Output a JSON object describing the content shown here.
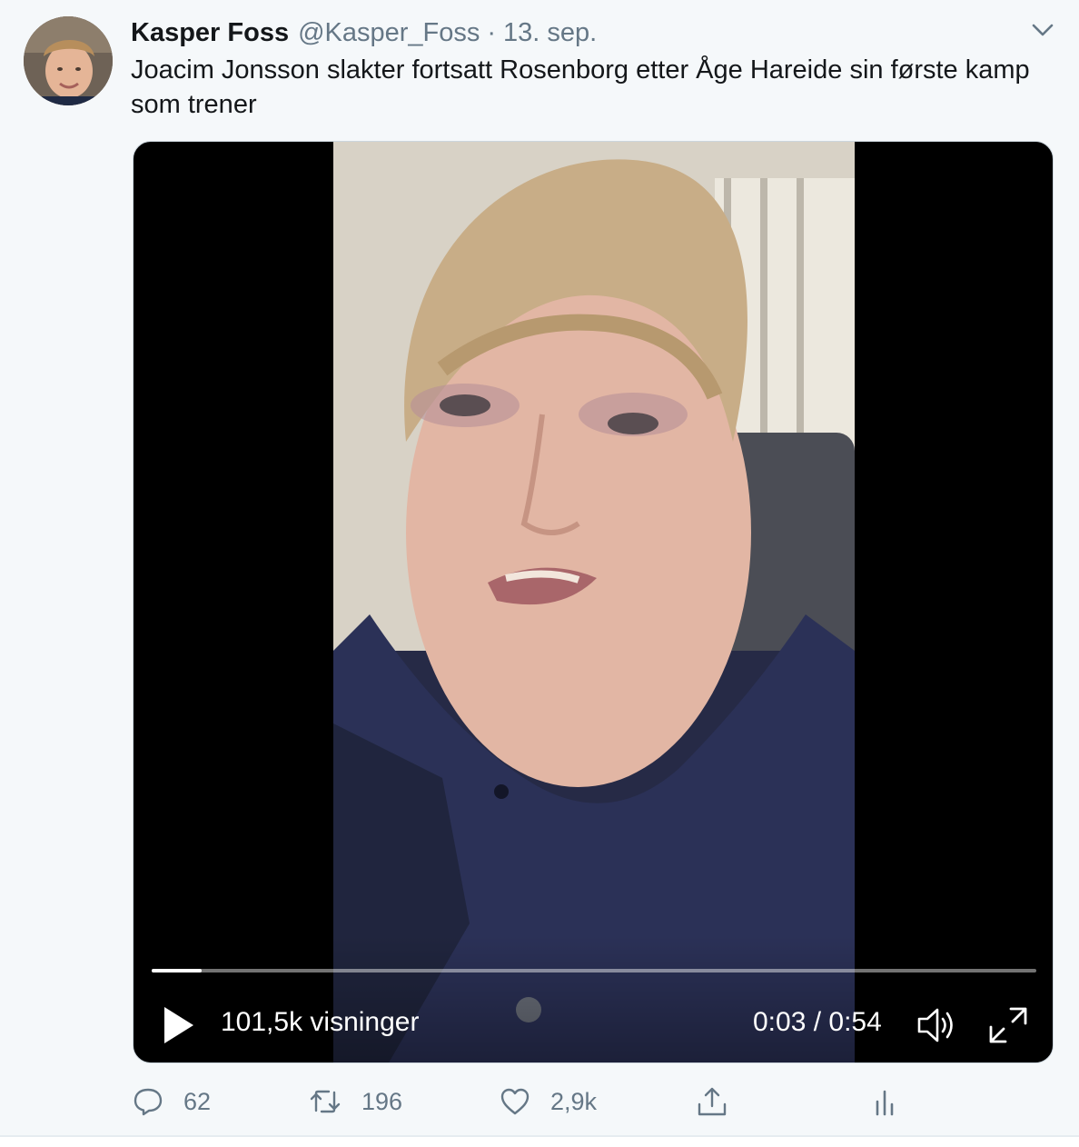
{
  "tweet": {
    "author_name": "Kasper Foss",
    "handle": "@Kasper_Foss",
    "separator": "·",
    "date": "13. sep.",
    "text": "Joacim Jonsson slakter fortsatt Rosenborg etter Åge Hareide sin første kamp som trener"
  },
  "video": {
    "views": "101,5k visninger",
    "time": "0:03 / 0:54",
    "progress": 0.056
  },
  "actions": {
    "replies": "62",
    "retweets": "196",
    "likes": "2,9k"
  },
  "icons": {
    "caret": "chevron-down-icon",
    "play": "play-icon",
    "volume": "volume-icon",
    "fullscreen": "fullscreen-icon",
    "reply": "reply-icon",
    "retweet": "retweet-icon",
    "like": "heart-icon",
    "share": "share-icon",
    "analytics": "analytics-icon"
  },
  "colors": {
    "background": "#f5f8fa",
    "text": "#14171a",
    "secondary": "#657786"
  }
}
